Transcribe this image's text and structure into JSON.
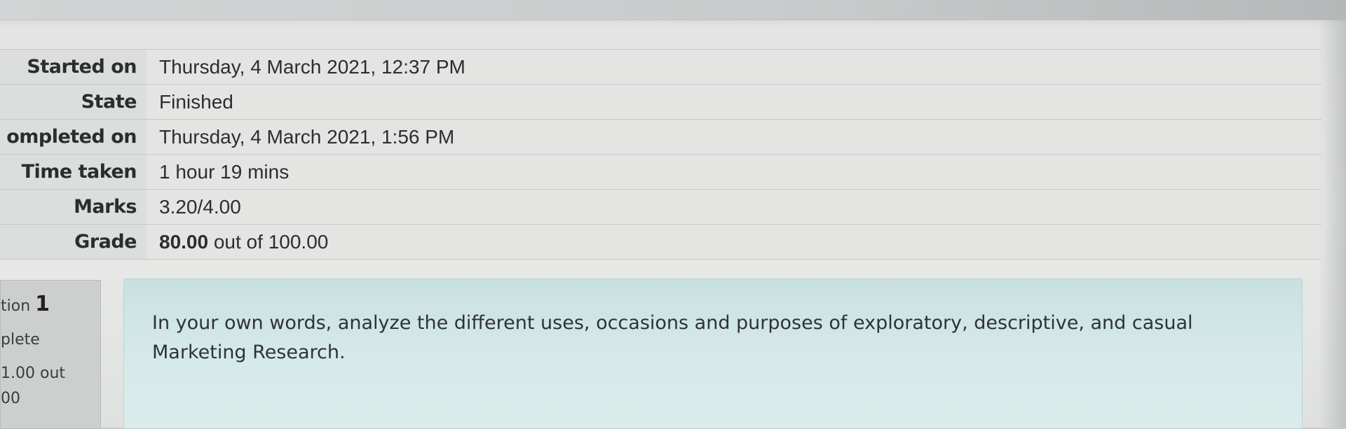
{
  "summary": {
    "rows": [
      {
        "label": "Started on",
        "value": "Thursday, 4 March 2021, 12:37 PM"
      },
      {
        "label": "State",
        "value": "Finished"
      },
      {
        "label": "ompleted on",
        "value": "Thursday, 4 March 2021, 1:56 PM"
      },
      {
        "label": "Time taken",
        "value": "1 hour 19 mins"
      },
      {
        "label": "Marks",
        "value": "3.20/4.00"
      },
      {
        "label": "Grade",
        "value_bold": "80.00",
        "value_rest": " out of 100.00"
      }
    ]
  },
  "question_info": {
    "number_prefix": "tion ",
    "number": "1",
    "state": "plete",
    "mark_line1": "1.00 out",
    "mark_line2": "00"
  },
  "question": {
    "text": "In your own words, analyze the different uses, occasions and purposes of exploratory, descriptive, and casual Marketing Research."
  }
}
